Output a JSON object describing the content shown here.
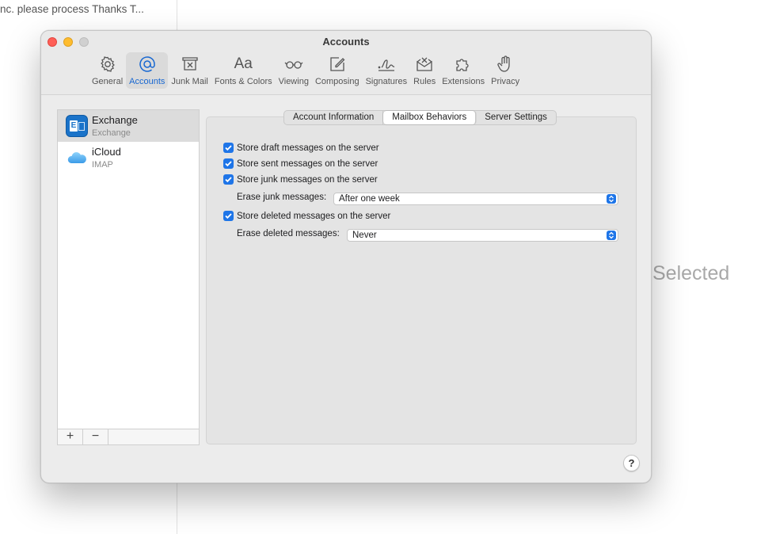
{
  "background": {
    "snippet": "nc. please process Thanks T...",
    "selected_label": "Selected"
  },
  "window": {
    "title": "Accounts"
  },
  "toolbar": {
    "items": [
      {
        "label": "General",
        "icon": "gear-icon"
      },
      {
        "label": "Accounts",
        "icon": "at-icon",
        "active": true
      },
      {
        "label": "Junk Mail",
        "icon": "junk-mail-icon"
      },
      {
        "label": "Fonts & Colors",
        "icon": "fonts-icon",
        "glyph": "Aa"
      },
      {
        "label": "Viewing",
        "icon": "glasses-icon"
      },
      {
        "label": "Composing",
        "icon": "compose-icon"
      },
      {
        "label": "Signatures",
        "icon": "signature-icon"
      },
      {
        "label": "Rules",
        "icon": "rules-icon"
      },
      {
        "label": "Extensions",
        "icon": "puzzle-icon"
      },
      {
        "label": "Privacy",
        "icon": "hand-icon"
      }
    ]
  },
  "accounts": [
    {
      "name": "Exchange",
      "type": "Exchange",
      "selected": true
    },
    {
      "name": "iCloud",
      "type": "IMAP",
      "selected": false
    }
  ],
  "list_footer": {
    "add": "+",
    "remove": "−"
  },
  "tabs": [
    {
      "label": "Account Information",
      "active": false
    },
    {
      "label": "Mailbox Behaviors",
      "active": true
    },
    {
      "label": "Server Settings",
      "active": false
    }
  ],
  "options": {
    "store_drafts": "Store draft messages on the server",
    "store_sent": "Store sent messages on the server",
    "store_junk": "Store junk messages on the server",
    "erase_junk_label": "Erase junk messages:",
    "erase_junk_value": "After one week",
    "store_deleted": "Store deleted messages on the server",
    "erase_deleted_label": "Erase deleted messages:",
    "erase_deleted_value": "Never"
  },
  "help": "?",
  "colors": {
    "accent": "#1e75e8",
    "close": "#ff5f57",
    "minimize": "#febc2e"
  }
}
